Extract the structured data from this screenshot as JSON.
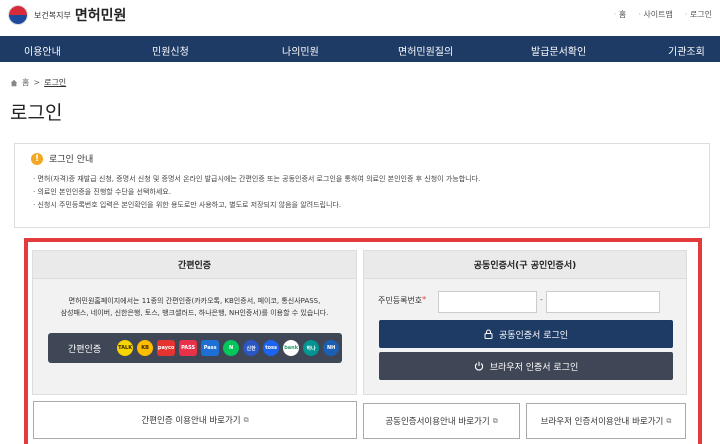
{
  "header": {
    "ministry": "보건복지부",
    "title": "면허민원",
    "util_links": [
      "홈",
      "사이트맵",
      "로그인"
    ]
  },
  "nav": {
    "items": [
      "이용안내",
      "민원신청",
      "나의민원",
      "면허민원질의",
      "발급문서확인",
      "기관조회"
    ]
  },
  "breadcrumb": {
    "home": "홈",
    "current": "로그인"
  },
  "page_title": "로그인",
  "notice": {
    "title": "로그인 안내",
    "lines": [
      "면허(자격)증 재발급 신청, 증명서 신청 및 증명서 온라인 발급시에는 간편인증 또는 공동인증서 로그인을 통하여 의료인 본인인증 후 신청이 가능합니다.",
      "의료인 본인인증을 진행할 수단을 선택하세요.",
      "신청시 주민등록번호 입력은 본인확인을 위한 용도로만 사용하고, 별도로 저장되지 않음을 알려드립니다."
    ]
  },
  "easy_auth": {
    "heading": "간편인증",
    "desc_line1": "면허민원홈페이지에서는 11종의 간편인증(카카오톡, KB인증서, 페이코, 통신사PASS,",
    "desc_line2": "삼성패스, 네이버, 신한은행, 토스, 뱅크샐러드, 하나은행, NH인증서)를 이용할 수 있습니다.",
    "button_label": "간편인증",
    "providers": [
      {
        "name": "TALK",
        "color": "#f7d500",
        "text": "#3a2a00"
      },
      {
        "name": "KB",
        "color": "#ffbc00",
        "text": "#3a2a00"
      },
      {
        "name": "payco",
        "color": "#e5342f",
        "text": "#ffffff"
      },
      {
        "name": "PASS",
        "color": "#e8324a",
        "text": "#ffffff"
      },
      {
        "name": "Pass",
        "color": "#1d6fd6",
        "text": "#ffffff"
      },
      {
        "name": "N",
        "color": "#03c75a",
        "text": "#ffffff"
      },
      {
        "name": "신한",
        "color": "#2a56c6",
        "text": "#ffffff"
      },
      {
        "name": "toss",
        "color": "#1b64f2",
        "text": "#ffffff"
      },
      {
        "name": "bank",
        "color": "#ffffff",
        "text": "#2b9d6b"
      },
      {
        "name": "하나",
        "color": "#009592",
        "text": "#ffffff"
      },
      {
        "name": "NH",
        "color": "#1a5fb4",
        "text": "#ffffff"
      }
    ],
    "guide_link": "간편인증 이용안내 바로가기"
  },
  "cert_auth": {
    "heading": "공동인증서(구 공인인증서)",
    "rrn_label": "주민등록번호",
    "required_mark": "*",
    "dash": "-",
    "login_button": "공동인증서 로그인",
    "browser_button": "브라우저 인증서 로그인",
    "guide_link": "공동인증서이용안내 바로가기",
    "browser_guide_link": "브라우저 인증서이용안내 바로가기"
  },
  "colors": {
    "nav_bg": "#1e3b66",
    "highlight_border": "#e33b3b",
    "dark_button": "#3f4756"
  }
}
